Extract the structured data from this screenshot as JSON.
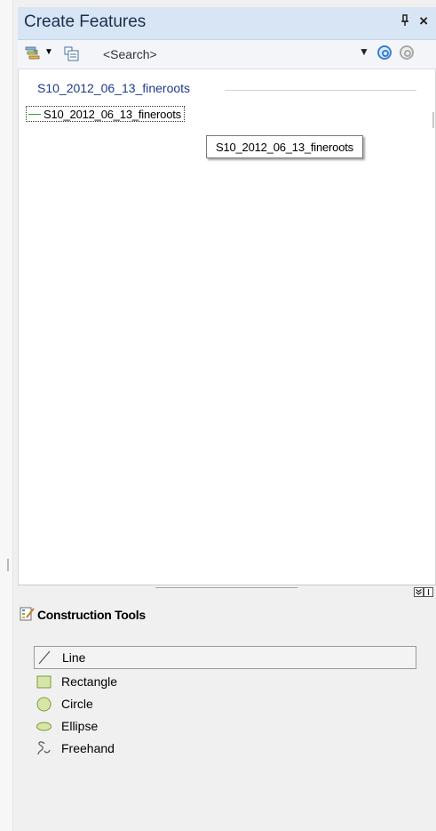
{
  "window": {
    "title": "Create Features",
    "pin_symbol": "ᵖ",
    "close_symbol": "×"
  },
  "toolbar": {
    "search_placeholder": "<Search>",
    "filter_icon": "filter-icon",
    "organize_icon": "organize-templates-icon",
    "search_icon": "search-icon",
    "clear_search_icon": "clear-search-icon",
    "dropdown_icon": "chevron-down-icon"
  },
  "templates": {
    "group_name": "S10_2012_06_13_fineroots",
    "items": [
      {
        "label": "S10_2012_06_13_fineroots",
        "swatch_color": "#37a336"
      }
    ],
    "tooltip": "S10_2012_06_13_fineroots"
  },
  "splitter": {
    "buttons": [
      "¥",
      "I"
    ]
  },
  "construction_tools": {
    "title": "Construction Tools",
    "items": [
      {
        "label": "Line",
        "icon": "line-icon",
        "selected": true
      },
      {
        "label": "Rectangle",
        "icon": "rectangle-icon",
        "selected": false
      },
      {
        "label": "Circle",
        "icon": "circle-icon",
        "selected": false
      },
      {
        "label": "Ellipse",
        "icon": "ellipse-icon",
        "selected": false
      },
      {
        "label": "Freehand",
        "icon": "freehand-icon",
        "selected": false
      }
    ]
  },
  "colors": {
    "titlebar_bg": "#d8e5f5",
    "group_header_text": "#1d3b8a",
    "shape_fill": "#d7e6a8",
    "shape_stroke": "#7c9b3a"
  }
}
